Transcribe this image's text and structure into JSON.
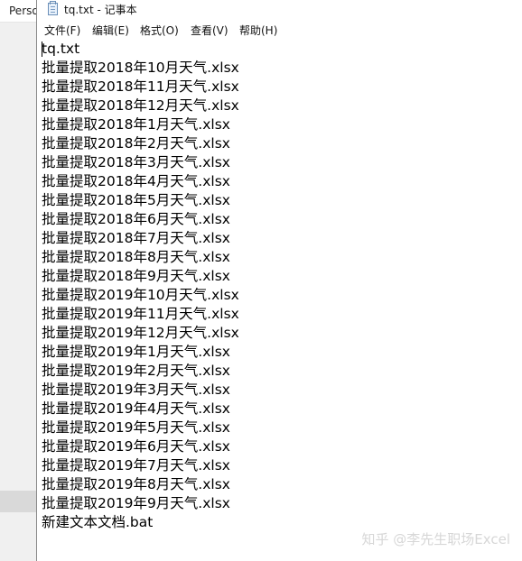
{
  "background_window": {
    "tab_label": "Perso"
  },
  "notepad": {
    "title": "tq.txt - 记事本",
    "icon": "notepad-icon",
    "menu": [
      "文件(F)",
      "编辑(E)",
      "格式(O)",
      "查看(V)",
      "帮助(H)"
    ],
    "lines": [
      "tq.txt",
      "批量提取2018年10月天气.xlsx",
      "批量提取2018年11月天气.xlsx",
      "批量提取2018年12月天气.xlsx",
      "批量提取2018年1月天气.xlsx",
      "批量提取2018年2月天气.xlsx",
      "批量提取2018年3月天气.xlsx",
      "批量提取2018年4月天气.xlsx",
      "批量提取2018年5月天气.xlsx",
      "批量提取2018年6月天气.xlsx",
      "批量提取2018年7月天气.xlsx",
      "批量提取2018年8月天气.xlsx",
      "批量提取2018年9月天气.xlsx",
      "批量提取2019年10月天气.xlsx",
      "批量提取2019年11月天气.xlsx",
      "批量提取2019年12月天气.xlsx",
      "批量提取2019年1月天气.xlsx",
      "批量提取2019年2月天气.xlsx",
      "批量提取2019年3月天气.xlsx",
      "批量提取2019年4月天气.xlsx",
      "批量提取2019年5月天气.xlsx",
      "批量提取2019年6月天气.xlsx",
      "批量提取2019年7月天气.xlsx",
      "批量提取2019年8月天气.xlsx",
      "批量提取2019年9月天气.xlsx",
      "新建文本文档.bat"
    ]
  },
  "watermark": "知乎 @李先生职场Excel"
}
